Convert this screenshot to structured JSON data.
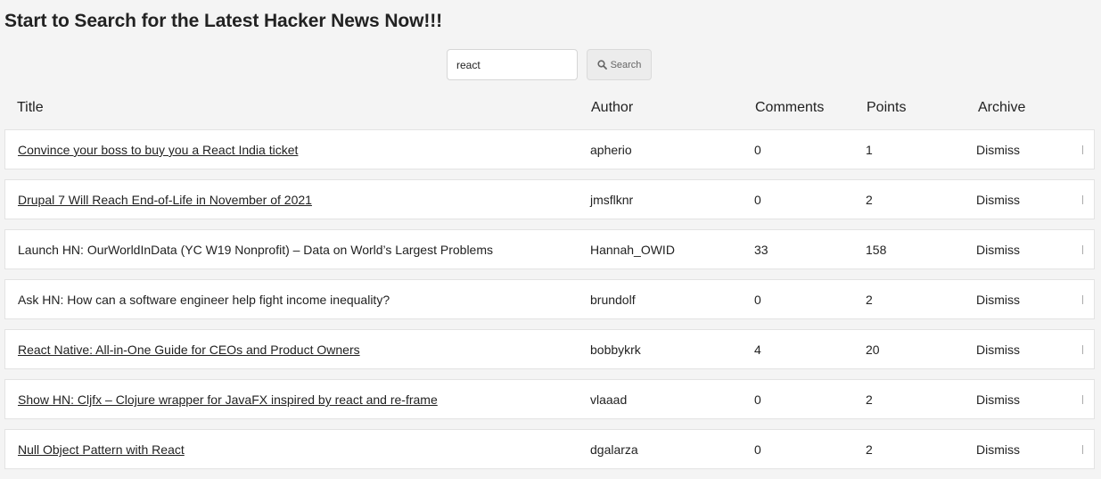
{
  "header": {
    "title": "Start to Search for the Latest Hacker News Now!!!"
  },
  "search": {
    "value": "react",
    "button_label": "Search",
    "button_icon": "search-icon"
  },
  "table": {
    "columns": [
      "Title",
      "Author",
      "Comments",
      "Points",
      "Archive"
    ],
    "dismiss_label": "Dismiss",
    "rows": [
      {
        "title": "Convince your boss to buy you a React India ticket",
        "link": true,
        "author": "apherio",
        "comments": "0",
        "points": "1"
      },
      {
        "title": "Drupal 7 Will Reach End-of-Life in November of 2021",
        "link": true,
        "author": "jmsflknr",
        "comments": "0",
        "points": "2"
      },
      {
        "title": "Launch HN: OurWorldInData (YC W19 Nonprofit) – Data on World’s Largest Problems",
        "link": false,
        "author": "Hannah_OWID",
        "comments": "33",
        "points": "158"
      },
      {
        "title": "Ask HN: How can a software engineer help fight income inequality?",
        "link": false,
        "author": "brundolf",
        "comments": "0",
        "points": "2"
      },
      {
        "title": "React Native: All-in-One Guide for CEOs and Product Owners",
        "link": true,
        "author": "bobbykrk",
        "comments": "4",
        "points": "20"
      },
      {
        "title": "Show HN: Cljfx – Clojure wrapper for JavaFX inspired by react and re-frame",
        "link": true,
        "author": "vlaaad",
        "comments": "0",
        "points": "2"
      },
      {
        "title": "Null Object Pattern with React",
        "link": true,
        "author": "dgalarza",
        "comments": "0",
        "points": "2"
      }
    ]
  }
}
